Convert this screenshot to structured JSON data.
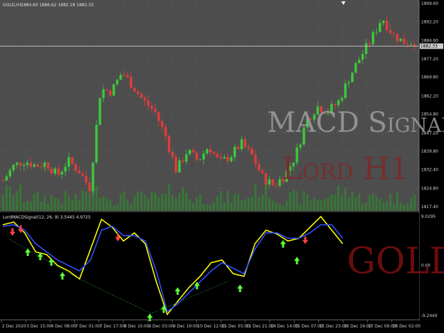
{
  "chart_data": [
    {
      "type": "candlestick",
      "header": {
        "symbol_label": "GOLD,H1",
        "values": "1884.60 1886.62 1882.18 1882.33"
      },
      "current_price_label": "1882.33",
      "y_ticks": [
        "1899.60",
        "1892.20",
        "1884.60",
        "1877.20",
        "1869.80",
        "1862.20",
        "1854.80",
        "1847.20",
        "1839.80",
        "1832.40",
        "1824.80",
        "1817.40"
      ],
      "ylim": [
        1817.4,
        1899.6
      ],
      "current_price": 1882.33,
      "x_labels": [
        "2 Dec 2020",
        "3 Dec 15:00",
        "4 Dec 08:00",
        "7 Dec 01:00",
        "7 Dec 17:00",
        "8 Dec 10:00",
        "9 Dec 03:00",
        "9 Dec 19:00",
        "10 Dec 12:00",
        "11 Dec 05:00",
        "11 Dec 21:00",
        "14 Dec 14:00",
        "15 Dec 07:00",
        "15 Dec 23:00",
        "16 Dec 16:00",
        "17 Dec 09:00",
        "18 Dec 02:00"
      ],
      "price_path": [
        1828,
        1834,
        1836,
        1834,
        1835,
        1830,
        1836,
        1832,
        1825,
        1865,
        1864,
        1872,
        1866,
        1860,
        1856,
        1846,
        1832,
        1840,
        1836,
        1842,
        1835,
        1838,
        1843,
        1838,
        1829,
        1826,
        1830,
        1838,
        1852,
        1858,
        1856,
        1860,
        1870,
        1878,
        1885,
        1894,
        1887,
        1884,
        1884
      ],
      "colors": {
        "up": "#3cc83c",
        "down": "#e03c3c",
        "volume": "#2c8a2c",
        "price_line": "#cccccc",
        "background": "#4d4d4d",
        "grid": "#5f5f5f"
      },
      "watermarks": {
        "line1": "MACD Signal",
        "line2": "Lord H1"
      },
      "watermark_colors": {
        "line1": "#9e9e9e",
        "line2": "#7a2b2b"
      }
    },
    {
      "type": "line",
      "header_label": "LordMACDSignal(12, 26, 9) 3.5445 4.9725",
      "y_ticks": [
        "9.0295",
        "0.00",
        "-9.2449"
      ],
      "ylim": [
        -9.2449,
        9.0295
      ],
      "series": [
        {
          "color": "#ffff00",
          "values": [
            7.5,
            8.0,
            6.0,
            2.5,
            2.0,
            0.0,
            -1.0,
            -2.5,
            3.0,
            8.5,
            7.0,
            4.5,
            6.0,
            4.0,
            -3.0,
            -9.0,
            -6.5,
            -4.0,
            -2.0,
            0.5,
            1.0,
            -1.5,
            -2.0,
            4.0,
            6.5,
            5.8,
            4.5,
            5.0,
            7.0,
            9.0,
            6.5,
            4.0
          ]
        },
        {
          "color": "#2f4fff",
          "values": [
            7.2,
            7.5,
            6.5,
            4.0,
            2.5,
            1.0,
            0.0,
            -1.0,
            1.0,
            6.5,
            7.2,
            5.5,
            5.5,
            4.5,
            -1.0,
            -8.5,
            -7.0,
            -5.0,
            -3.0,
            -1.0,
            0.5,
            -0.5,
            -1.5,
            3.0,
            6.0,
            6.0,
            5.0,
            5.0,
            6.0,
            7.5,
            7.5,
            5.0
          ]
        }
      ],
      "signals": {
        "buy_color": "#5cff3c",
        "sell_color": "#ff4040"
      },
      "watermark": "GOLD",
      "watermark_color": "#6a0d0d"
    }
  ]
}
